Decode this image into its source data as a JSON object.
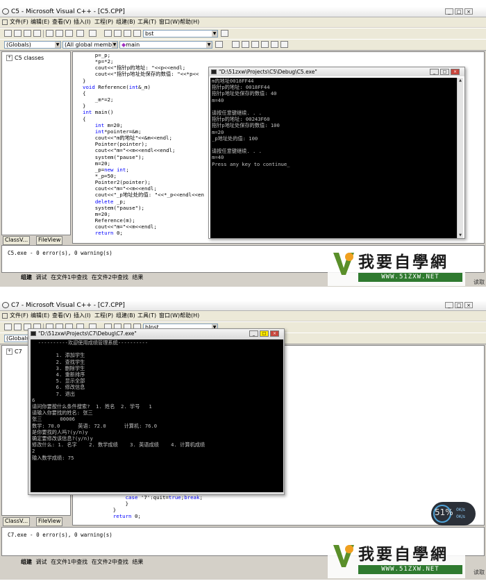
{
  "menu": [
    "文件(F)",
    "编辑(E)",
    "查看(V)",
    "插入(I)",
    "工程(P)",
    "组建(B)",
    "工具(T)",
    "窗口(W)",
    "帮助(H)"
  ],
  "output_tabs": [
    "组建",
    "调试",
    "在文件1中查找",
    "在文件2中查找",
    "结果"
  ],
  "left_tabs": [
    "ClassV...",
    "FileView"
  ],
  "watermark": {
    "brand": "我要自學網",
    "site": "WWW.51ZXW.NET"
  },
  "top": {
    "title": "C5 - Microsoft Visual C++ - [C5.CPP]",
    "find_combo": "bst",
    "scope_combo": "(Globals)",
    "members_combo": "(All global member",
    "function_combo": "main",
    "class_tree_root": "C5 classes",
    "code": [
      "    p=_p;",
      "    *p=*2;",
      "    cout<<\"指针p的地址: \"<<p<<endl;",
      "    cout<<\"指针p地址处保存的数值: \"<<*p<<",
      "}",
      "void Reference(int&_m)",
      "{",
      "    _m*=2;",
      "}",
      "int main()",
      "{",
      "    int m=20;",
      "    int*pointer=&m;",
      "    cout<<\"m的地址\"<<&m<<endl;",
      "    Pointer(pointer);",
      "    cout<<\"m=\"<<m<<endl<<endl;",
      "    system(\"pause\");",
      "    m=20;",
      "    _p=new int;",
      "    *_p=50;",
      "    Pointer2(pointer);",
      "    cout<<\"m=\"<<m<<endl;",
      "    cout<<\"_p地址处的值: \"<<*_p<<endl<<en",
      "    delete _p;",
      "    system(\"pause\");",
      "    m=20;",
      "    Reference(m);",
      "    cout<<\"m=\"<<m<<endl;",
      "    return 0;"
    ],
    "console_title": "\"D:\\51zxw\\Projects\\C5\\Debug\\C5.exe\"",
    "console_lines": [
      "m的地址0018FF44",
      "指针p的地址: 0018FF44",
      "指针p地址处保存的数值: 40",
      "m=40",
      "",
      "请按任意键继续. . .",
      "指针p的地址: 00243F60",
      "指针p地址处保存的数值: 100",
      "m=20",
      "_p地址处的值: 100",
      "",
      "请按任意键继续. . .",
      "m=40",
      "Press any key to continue_"
    ],
    "build_output": "C5.exe - 0 error(s), 0 warning(s)",
    "cutoff_text": "读取"
  },
  "bottom": {
    "title": "C7 - Microsoft Visual C++ - [C7.CPP]",
    "find_combo": "hInst",
    "scope_combo": "(Globals)",
    "class_tree_root": "C7",
    "code": [
      "        case '7':quit=true;break;",
      "        }",
      "    }",
      "    return 0;"
    ],
    "console_title": "\"D:\\51zxw\\Projects\\C7\\Debug\\C7.exe\"",
    "console_lines": [
      "  ----------欢迎使用成绩管理系统----------",
      "",
      "        1. 添加学生",
      "        2. 查找学生",
      "        3. 删除学生",
      "        4. 重新排序",
      "        5. 显示全部",
      "        6. 修改信息",
      "        7. 退出",
      "6",
      "请问你要按什么条件搜索?  1. 姓名  2. 学号   1",
      "请输入你要找的姓名: 张三",
      "张三      00006",
      "数学: 70.0      英语: 72.0      计算机: 76.0",
      "是你要找的人吗?(y/n)y",
      "确定要修改该信息?(y/n)y",
      "修改什么: 1. 名字    2. 数学成绩    3. 英语成绩    4. 计算机成绩",
      "2",
      "输入数学成绩: 75"
    ],
    "build_output": "C7.exe - 0 error(s), 0 warning(s)",
    "cutoff_text": "读取",
    "bubble": {
      "percent": "51%",
      "line1": "0K/s",
      "line2": "0K/s"
    }
  }
}
